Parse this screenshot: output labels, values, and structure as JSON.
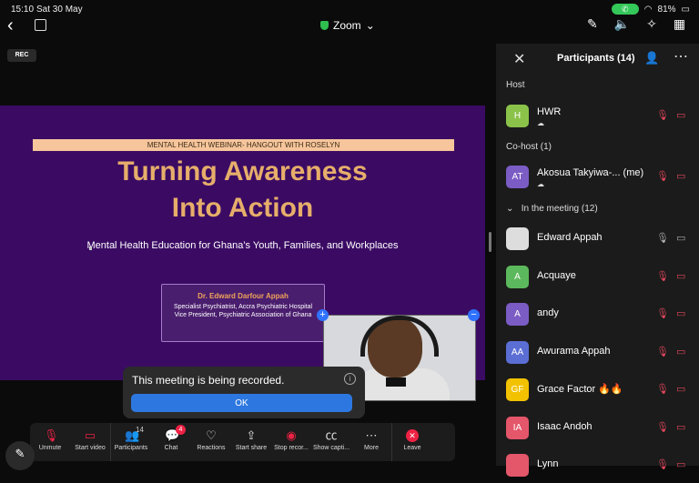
{
  "status": {
    "time": "15:10",
    "date": "Sat 30 May",
    "battery": "81%"
  },
  "app": {
    "title": "Zoom"
  },
  "rec_label": "REC",
  "slide": {
    "banner": "MENTAL HEALTH WEBINAR- HANGOUT WITH ROSELYN",
    "title_line1": "Turning Awareness",
    "title_line2": "Into Action",
    "subtitle": "Mental Health Education for Ghana’s Youth, Families, and Workplaces",
    "presenter_name": "Dr. Edward Darfour Appah",
    "presenter_line1": "Specialist Psychiatrist, Accra Psychiatric Hospital",
    "presenter_line2": "Vice President, Psychiatric Association of Ghana"
  },
  "toast": {
    "message": "This meeting is being recorded.",
    "ok_label": "OK"
  },
  "toolbar": {
    "unmute": "Unmute",
    "start_video": "Start video",
    "participants": "Participants",
    "participants_count": "14",
    "chat": "Chat",
    "chat_badge": "4",
    "reactions": "Reactions",
    "start_share": "Start share",
    "stop_recording": "Stop recor...",
    "show_captions": "Show capti...",
    "more": "More",
    "leave": "Leave"
  },
  "panel": {
    "title": "Participants (14)",
    "host_header": "Host",
    "cohost_header": "Co-host (1)",
    "meeting_header": "In the meeting (12)",
    "host": {
      "initials": "H",
      "name": "HWR",
      "color": "#8bc34a"
    },
    "cohost": {
      "initials": "AT",
      "name": "Akosua Takyiwa-...  (me)",
      "color": "#7b5cc4"
    },
    "participants": [
      {
        "initials": "",
        "name": "Edward Appah",
        "color": "#dddddd"
      },
      {
        "initials": "A",
        "name": "Acquaye",
        "color": "#5cb85c"
      },
      {
        "initials": "A",
        "name": "andy",
        "color": "#7b5cc4"
      },
      {
        "initials": "AA",
        "name": "Awurama Appah",
        "color": "#5b6ed4"
      },
      {
        "initials": "GF",
        "name": "Grace Factor 🔥🔥",
        "color": "#f2c200"
      },
      {
        "initials": "IA",
        "name": "Isaac Andoh",
        "color": "#e4566a"
      },
      {
        "initials": "",
        "name": "Lynn",
        "color": "#e4566a"
      }
    ]
  }
}
